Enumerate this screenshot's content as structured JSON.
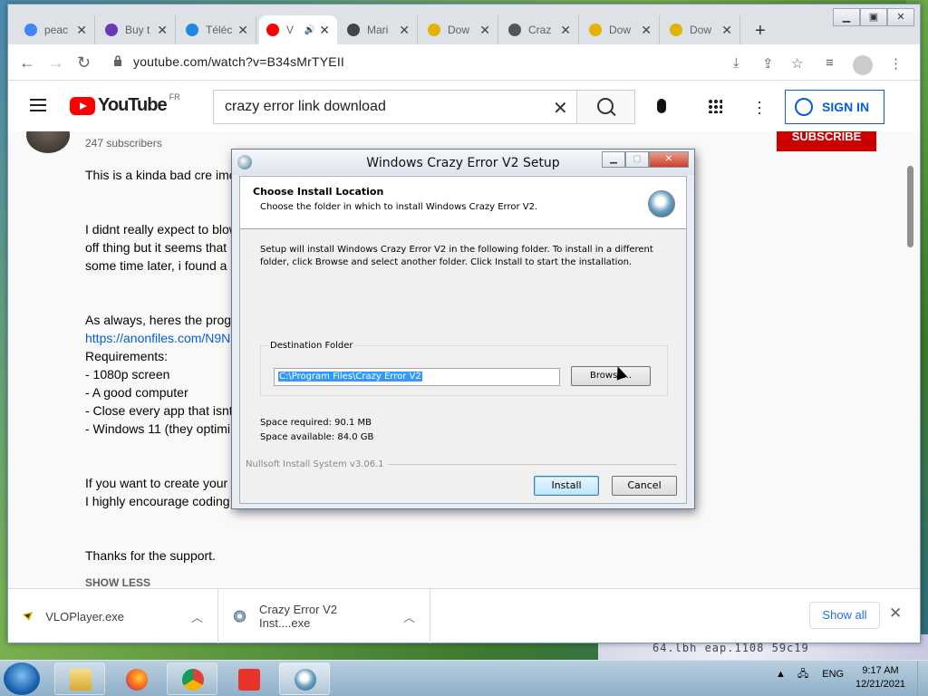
{
  "browser": {
    "tabs": [
      {
        "label": "peac",
        "favicon": "google-icon",
        "color": "#4285f4"
      },
      {
        "label": "Buy t",
        "favicon": "shield-icon",
        "color": "#6a3ab0"
      },
      {
        "label": "Téléc",
        "favicon": "download-site-icon",
        "color": "#1e88e5"
      },
      {
        "label": "V",
        "favicon": "youtube-icon",
        "color": "#ff0000",
        "active": true
      },
      {
        "label": "Mari",
        "favicon": "site-icon",
        "color": "#444444"
      },
      {
        "label": "Dow",
        "favicon": "vlo-icon",
        "color": "#e0b400"
      },
      {
        "label": "Craz",
        "favicon": "globe-icon",
        "color": "#555555"
      },
      {
        "label": "Dow",
        "favicon": "vlo-icon",
        "color": "#e0b400"
      },
      {
        "label": "Dow",
        "favicon": "vlo-icon",
        "color": "#e0b400"
      }
    ],
    "new_tab": "+",
    "url": "youtube.com/watch?v=B34sMrTYEII"
  },
  "youtube": {
    "logo_text": "YouTube",
    "region": "FR",
    "search_query": "crazy error link download",
    "sign_in": "SIGN IN",
    "subscribe": "SUBSCRIBE",
    "subscribers": "247 subscribers",
    "description": {
      "l1": "This is a kinda bad cre imo",
      "l2": "I didnt really expect to blow",
      "l3": "off thing but it seems that",
      "l4": "some time later, i found a",
      "l5": "As always, heres the progr",
      "l6": "https://anonfiles.com/N9N",
      "l7": "Requirements:",
      "l8": "- 1080p screen",
      "l9": "- A good computer",
      "l10": "- Close every app that isnt",
      "l11": "- Windows 11 (they optimi",
      "l12": "If you want to create your",
      "l13": "I highly encourage coding",
      "l14": "Thanks for the support."
    },
    "show_less": "SHOW LESS"
  },
  "downloads": {
    "items": [
      {
        "name": "VLOPlayer.exe"
      },
      {
        "name": "Crazy Error V2 Inst....exe"
      }
    ],
    "show_all": "Show all"
  },
  "installer": {
    "title": "Windows Crazy Error V2 Setup",
    "heading": "Choose Install Location",
    "subheading": "Choose the folder in which to install Windows Crazy Error V2.",
    "body": "Setup will install Windows Crazy Error V2 in the following folder. To install in a different folder, click Browse and select another folder. Click Install to start the installation.",
    "dest_label": "Destination Folder",
    "dest_path": "C:\\Program Files\\Crazy Error V2",
    "browse": "Browse...",
    "space_required": "Space required: 90.1 MB",
    "space_available": "Space available: 84.0 GB",
    "branding": "Nullsoft Install System v3.06.1",
    "install": "Install",
    "cancel": "Cancel"
  },
  "taskbar": {
    "language": "ENG",
    "time": "9:17 AM",
    "date": "12/21/2021"
  },
  "desktop": {
    "background_text": "64.lbh  eap.1108   59c19"
  }
}
